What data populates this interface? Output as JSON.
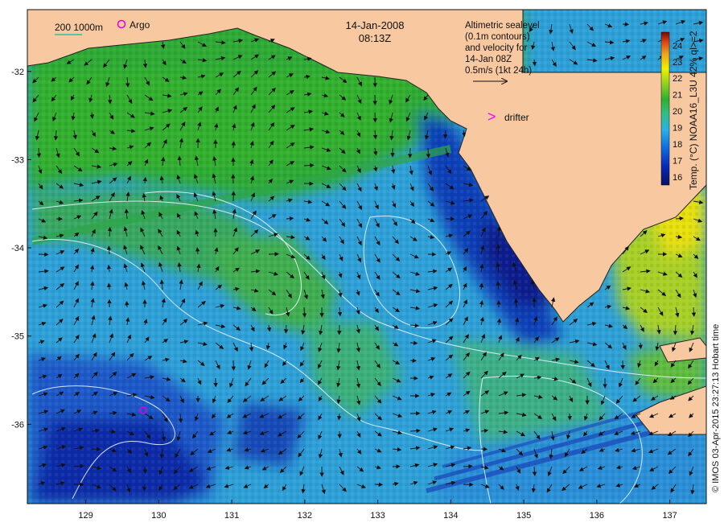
{
  "date_label": "14-Jan-2008",
  "time_label": "08:13Z",
  "scale_label": "200  1000m",
  "argo_label": "Argo",
  "drifter_label": "drifter",
  "drifter_symbol": ">",
  "info_lines": [
    "Altimetric sealevel",
    "(0.1m contours)",
    "and velocity for",
    "14-Jan 08Z",
    "0.5m/s (1kt 24h)"
  ],
  "colorbar": {
    "title": "Temp. (°C) NOAA16_L3U 42% ql>=2",
    "ticks": [
      "16",
      "17",
      "18",
      "19",
      "20",
      "21",
      "22",
      "23",
      "24"
    ],
    "min": 15.5,
    "max": 24.8
  },
  "copyright": "© IMOS 03-Apr-2015 23:27:13 Hobart time",
  "axes": {
    "x_ticks": [
      "129",
      "130",
      "131",
      "132",
      "133",
      "134",
      "135",
      "136",
      "137"
    ],
    "y_ticks": [
      "-32",
      "-33",
      "-34",
      "-35",
      "-36"
    ],
    "x_values": [
      129,
      130,
      131,
      132,
      133,
      134,
      135,
      136,
      137
    ],
    "y_values": [
      -32,
      -33,
      -34,
      -35,
      -36
    ],
    "x_range": [
      128.2,
      137.5
    ],
    "y_range": [
      -36.9,
      -31.3
    ]
  },
  "colors": {
    "land": "#f8c8a0",
    "sst_warm": "#30b030",
    "sst_mid": "#2ea0d8",
    "sst_cold": "#08209a",
    "argo": "#e000e0",
    "drifter": "#ff00ff",
    "contour": "#e8f4ff"
  }
}
